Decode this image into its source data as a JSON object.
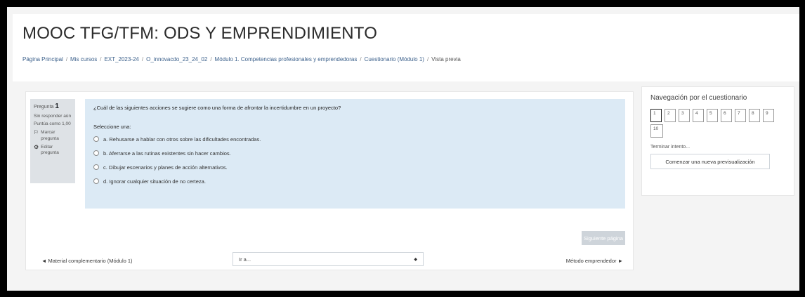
{
  "page": {
    "title": "MOOC TFG/TFM: ODS Y EMPRENDIMIENTO",
    "breadcrumb": [
      "Página Principal",
      "Mis cursos",
      "EXT_2023-24",
      "O_innovacdo_23_24_02",
      "Módulo 1. Competencias profesionales y emprendedoras",
      "Cuestionario (Módulo 1)",
      "Vista previa"
    ],
    "breadcrumb_separator": "/"
  },
  "question_info": {
    "label": "Pregunta",
    "number": "1",
    "status": "Sin responder aún",
    "grade": "Puntúa como 1,00",
    "flag": "Marcar pregunta",
    "edit": "Editar pregunta",
    "flag_icon": "flag-icon",
    "edit_icon": "gear-icon"
  },
  "question": {
    "text": "¿Cuál de las siguientes acciones se sugiere como una forma de afrontar la incertidumbre en un proyecto?",
    "prompt": "Seleccione una:",
    "answers": [
      "a.  Rehusarse a hablar con otros sobre las dificultades encontradas.",
      "b.  Aferrarse a las rutinas existentes sin hacer cambios.",
      "c. Dibujar escenarios y planes de acción alternativos.",
      "d.  Ignorar cualquier situación de no certeza."
    ]
  },
  "controls": {
    "next_page": "Siguiente página",
    "prev_link": "◄ Material complementario (Módulo 1)",
    "jump_placeholder": "Ir a...",
    "jump_caret": "◆",
    "next_link": "Método emprendedor ►"
  },
  "quiz_nav": {
    "title": "Navegación por el cuestionario",
    "buttons": [
      "1",
      "2",
      "3",
      "4",
      "5",
      "6",
      "7",
      "8",
      "9",
      "10"
    ],
    "current": "1",
    "finish": "Terminar intento...",
    "restart": "Comenzar una nueva previsualización"
  },
  "colors": {
    "question_bg": "#dceaf5",
    "info_bg": "#dee2e6",
    "button_disabled": "#ced4da"
  }
}
